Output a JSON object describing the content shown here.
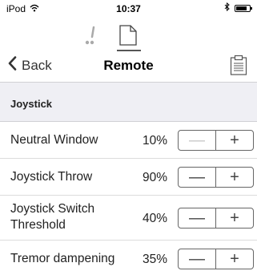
{
  "status": {
    "carrier": "iPod",
    "time": "10:37"
  },
  "nav": {
    "back_label": "Back",
    "title": "Remote"
  },
  "section": {
    "title": "Joystick"
  },
  "rows": [
    {
      "label": "Neutral Window",
      "value": "10%",
      "minus_enabled": false
    },
    {
      "label": "Joystick Throw",
      "value": "90%",
      "minus_enabled": true
    },
    {
      "label": "Joystick Switch Threshold",
      "value": "40%",
      "minus_enabled": true
    },
    {
      "label": "Tremor dampening",
      "value": "35%",
      "minus_enabled": true
    }
  ],
  "stepper": {
    "minus_symbol": "—",
    "plus_symbol": "+"
  },
  "colors": {
    "section_background": "#efeff4",
    "divider": "#dcdcdc",
    "disabled": "#c8c8c8"
  }
}
